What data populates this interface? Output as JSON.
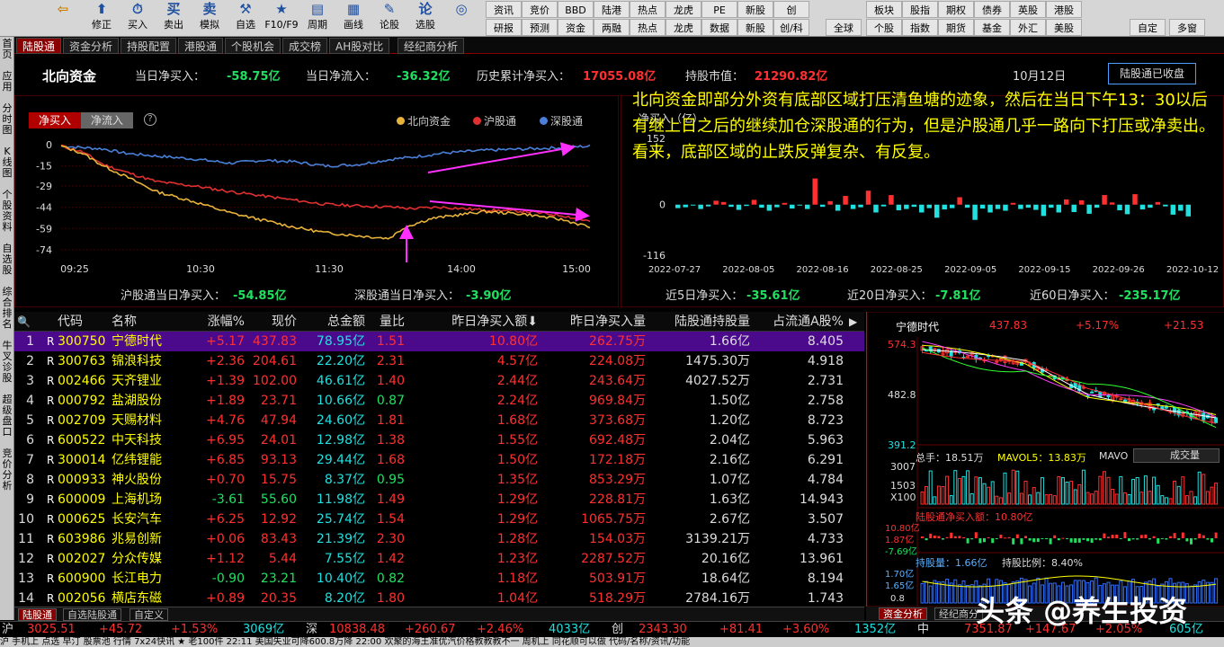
{
  "toolbar": {
    "items": [
      {
        "icon": "⇦",
        "label": ""
      },
      {
        "icon": "⬆",
        "label": "修正"
      },
      {
        "icon": "⏱",
        "label": "买入"
      },
      {
        "icon": "买",
        "label": "卖出"
      },
      {
        "icon": "卖",
        "label": "模拟"
      },
      {
        "icon": "⚒",
        "label": "自选"
      },
      {
        "icon": "★",
        "label": "F10/F9"
      },
      {
        "icon": "▤",
        "label": "周期"
      },
      {
        "icon": "▦",
        "label": "画线"
      },
      {
        "icon": "✎",
        "label": "论股"
      },
      {
        "icon": "论",
        "label": "选股"
      },
      {
        "icon": "◎",
        "label": ""
      }
    ],
    "grid": [
      [
        "资讯",
        "竞价",
        "BBD",
        "陆港",
        "热点",
        "龙虎",
        "PE",
        "新股",
        "创"
      ],
      [
        "研报",
        "预测",
        "资金",
        "两融",
        "热点",
        "龙虎",
        "数据",
        "新股",
        "创/科"
      ]
    ],
    "right_grid": [
      [
        "板块",
        "股指",
        "期权",
        "债券",
        "英股",
        "港股"
      ],
      [
        "个股",
        "指数",
        "期货",
        "基金",
        "外汇",
        "美股"
      ]
    ],
    "extra": [
      "全球",
      "自定",
      "多窗"
    ]
  },
  "leftbar": [
    "首页",
    "应用",
    "分时图",
    "K线图",
    "个股资料",
    "自选股",
    "综合排名",
    "牛叉诊股",
    "超级盘口",
    "竞价分析"
  ],
  "tabs": [
    "陆股通",
    "资金分析",
    "持股配置",
    "港股通",
    "个股机会",
    "成交榜",
    "AH股对比",
    "经纪商分析"
  ],
  "header": {
    "title": "北向资金",
    "net_buy_label": "当日净买入：",
    "net_buy": "-58.75亿",
    "net_inflow_label": "当日净流入：",
    "net_inflow": "-36.32亿",
    "hist_label": "历史累计净买入：",
    "hist": "17055.08亿",
    "mv_label": "持股市值：",
    "mv": "21290.82亿",
    "date": "10月12日",
    "close_btn": "陆股通已收盘"
  },
  "left_panel": {
    "btn_buy": "净买入",
    "btn_inflow": "净流入",
    "help": "?",
    "legend": [
      "北向资金",
      "沪股通",
      "深股通"
    ],
    "yticks": [
      "0",
      "-15",
      "-29",
      "-44",
      "-59",
      "-74"
    ],
    "xticks": [
      "09:25",
      "10:30",
      "11:30",
      "14:00",
      "15:00"
    ],
    "sh_label": "沪股通当日净买入：",
    "sh_val": "-54.85亿",
    "sz_label": "深股通当日净买入：",
    "sz_val": "-3.90亿"
  },
  "right_panel": {
    "title": "净买入（亿）",
    "yticks": [
      "152",
      "0",
      "-116"
    ],
    "xticks": [
      "2022-07-27",
      "2022-08-05",
      "2022-08-16",
      "2022-08-25",
      "2022-09-05",
      "2022-09-15",
      "2022-09-26",
      "2022-10-12"
    ],
    "d5_label": "近5日净买入：",
    "d5": "-35.61亿",
    "d20_label": "近20日净买入：",
    "d20": "-7.81亿",
    "d60_label": "近60日净买入：",
    "d60": "-235.17亿"
  },
  "annotation": "北向资金即部分外资有底部区域打压清鱼塘的迹象，然后在当日下午13：30以后有继上日之后的继续加仓深股通的行为，但是沪股通几乎一路向下打压或净卖出。看来，底部区域的止跌反弹复杂、有反复。",
  "colors": {
    "north": "#e8b33a",
    "sh": "#e03030",
    "sz": "#4a7fd8",
    "arrow": "#ff30ff",
    "up": "#ff3030",
    "down": "#20e0e0",
    "yellow": "#ffff00"
  },
  "table": {
    "headers": [
      "",
      "代码",
      "名称",
      "涨幅%",
      "现价",
      "总金额",
      "量比",
      "昨日净买入额⬇",
      "昨日净买入量",
      "陆股通持股量",
      "占流通A股%"
    ],
    "rows": [
      [
        "1",
        "R",
        "300750",
        "宁德时代",
        "+5.17",
        "437.83",
        "78.95亿",
        "1.51",
        "10.80亿",
        "262.75万",
        "1.66亿",
        "8.405"
      ],
      [
        "2",
        "R",
        "300763",
        "锦浪科技",
        "+2.36",
        "204.61",
        "22.20亿",
        "2.31",
        "4.57亿",
        "224.08万",
        "1475.30万",
        "4.918"
      ],
      [
        "3",
        "R",
        "002466",
        "天齐锂业",
        "+1.39",
        "102.00",
        "46.61亿",
        "1.40",
        "2.44亿",
        "243.64万",
        "4027.52万",
        "2.731"
      ],
      [
        "4",
        "R",
        "000792",
        "盐湖股份",
        "+1.89",
        "23.71",
        "10.66亿",
        "0.87",
        "2.24亿",
        "969.84万",
        "1.50亿",
        "2.758"
      ],
      [
        "5",
        "R",
        "002709",
        "天赐材料",
        "+4.76",
        "47.94",
        "24.60亿",
        "1.81",
        "1.68亿",
        "373.68万",
        "1.20亿",
        "8.723"
      ],
      [
        "6",
        "R",
        "600522",
        "中天科技",
        "+6.95",
        "24.01",
        "12.98亿",
        "1.38",
        "1.55亿",
        "692.48万",
        "2.04亿",
        "5.963"
      ],
      [
        "7",
        "R",
        "300014",
        "亿纬锂能",
        "+6.85",
        "93.13",
        "29.44亿",
        "1.68",
        "1.50亿",
        "172.18万",
        "2.16亿",
        "6.291"
      ],
      [
        "8",
        "R",
        "000933",
        "神火股份",
        "+0.70",
        "15.75",
        "8.37亿",
        "0.95",
        "1.35亿",
        "853.29万",
        "1.07亿",
        "4.784"
      ],
      [
        "9",
        "R",
        "600009",
        "上海机场",
        "-3.61",
        "55.60",
        "11.98亿",
        "1.49",
        "1.29亿",
        "228.81万",
        "1.63亿",
        "14.943"
      ],
      [
        "10",
        "R",
        "000625",
        "长安汽车",
        "+6.25",
        "12.92",
        "25.74亿",
        "1.54",
        "1.29亿",
        "1065.75万",
        "2.67亿",
        "3.507"
      ],
      [
        "11",
        "R",
        "603986",
        "兆易创新",
        "+0.06",
        "83.43",
        "21.39亿",
        "2.30",
        "1.28亿",
        "154.03万",
        "3139.21万",
        "4.733"
      ],
      [
        "12",
        "R",
        "002027",
        "分众传媒",
        "+1.12",
        "5.44",
        "7.55亿",
        "1.42",
        "1.23亿",
        "2287.52万",
        "20.16亿",
        "13.961"
      ],
      [
        "13",
        "R",
        "600900",
        "长江电力",
        "-0.90",
        "23.21",
        "10.40亿",
        "0.82",
        "1.18亿",
        "503.91万",
        "18.64亿",
        "8.194"
      ],
      [
        "14",
        "R",
        "002056",
        "横店东磁",
        "+0.89",
        "20.35",
        "8.20亿",
        "1.80",
        "1.04亿",
        "518.29万",
        "2784.16万",
        "1.743"
      ]
    ]
  },
  "stock_panel": {
    "name": "宁德时代",
    "price": "437.83",
    "pct": "+5.17%",
    "chg": "+21.53",
    "yhigh": "574.3",
    "ymid": "482.8",
    "ylow": "391.2",
    "vol_label": "总手：18.51万",
    "mavol5": "MAVOL5：13.83万",
    "mavol": "MAVO",
    "vol_sel": "成交量",
    "vol_y": [
      "3007",
      "1503",
      "X100"
    ],
    "net_label": "陆股通净买入额：10.80亿",
    "net_y": [
      "10.80亿",
      "1.87亿",
      "-7.69亿"
    ],
    "hold_label": "持股量：1.66亿",
    "ratio_label": "持股比例：8.40%",
    "hold_y": [
      "1.70亿",
      "1.65亿",
      "0.8"
    ]
  },
  "bottom_tabs": [
    "陆股通",
    "自选陆股通",
    "自定义"
  ],
  "right_bottom_tabs": [
    "资金分析",
    "经纪商分"
  ],
  "status": {
    "sh_name": "沪",
    "sh_idx": "3025.51",
    "sh_chg": "+45.72",
    "sh_pct": "+1.53%",
    "sh_amt": "3069亿",
    "sz_name": "深",
    "sz_idx": "10838.48",
    "sz_chg": "+260.67",
    "sz_pct": "+2.46%",
    "sz_amt": "4033亿",
    "cy_name": "创",
    "cy_idx": "2343.30",
    "cy_chg": "+81.41",
    "cy_pct": "+3.60%",
    "cy_amt": "1352亿",
    "zh_name": "中",
    "zh_idx": "7351.87",
    "zh_chg": "+147.67",
    "zh_pct": "+2.05%",
    "zh_amt": "605亿"
  },
  "status2": "沪 手机上 点选 早汀 股票池 行情 7x24快讯 ★ 老100件 22:11 美国失业可降600.8万降 22:00 欢聚的海王准优汽价格教教教不一 周机上 同花顺可以做 代码/名称/资讯/功能",
  "watermark": "头条 @养生投资",
  "chart_data": [
    {
      "type": "line",
      "title": "",
      "series": [
        {
          "name": "北向资金"
        },
        {
          "name": "沪股通"
        },
        {
          "name": "深股通"
        }
      ],
      "x": [
        "09:25",
        "10:30",
        "11:30",
        "14:00",
        "15:00"
      ],
      "ylim": [
        -74,
        0
      ]
    },
    {
      "type": "bar",
      "title": "",
      "x": [
        "2022-07-27",
        "2022-08-05",
        "2022-08-16",
        "2022-08-25",
        "2022-09-05",
        "2022-09-15",
        "2022-09-26",
        "2022-10-12"
      ],
      "values": [
        -8,
        -6,
        -2,
        -10,
        -4,
        9,
        6,
        -5,
        -12,
        -3,
        11,
        -7,
        -14,
        -6,
        4,
        -9,
        -2,
        -10,
        60,
        -5,
        8,
        -14,
        20,
        -10,
        -6,
        32,
        -18,
        -4,
        22,
        -13,
        -10,
        -5,
        -18,
        -8,
        -30,
        -11,
        -8,
        17,
        -7,
        -35,
        -9,
        -18,
        -10,
        -14,
        4,
        -10,
        -7,
        -12,
        -26,
        -7,
        -18,
        12,
        -17,
        10,
        -21,
        -7,
        22,
        5,
        -13,
        -22,
        24,
        -11,
        -7,
        6,
        -4,
        -23,
        -14,
        -27
      ],
      "ylim": [
        -116,
        152
      ]
    }
  ]
}
